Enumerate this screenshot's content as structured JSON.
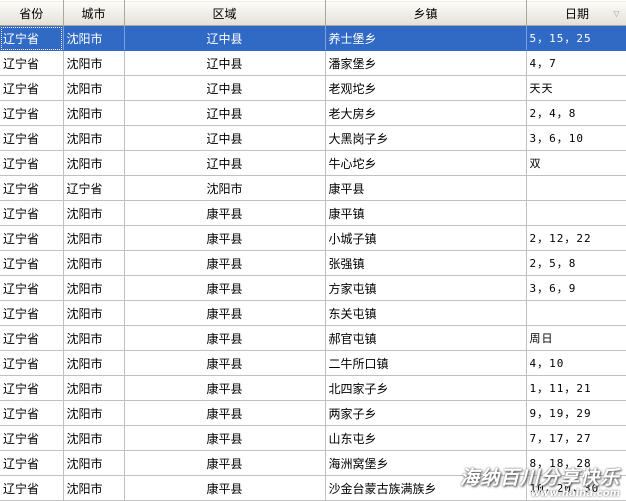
{
  "headers": {
    "province": "省份",
    "city": "城市",
    "area": "区域",
    "town": "乡镇",
    "date": "日期"
  },
  "sort_indicator": "▽",
  "rows": [
    {
      "province": "辽宁省",
      "city": "沈阳市",
      "area": "辽中县",
      "town": "养士堡乡",
      "date": "5，15，25",
      "selected": true
    },
    {
      "province": "辽宁省",
      "city": "沈阳市",
      "area": "辽中县",
      "town": "潘家堡乡",
      "date": "4，7"
    },
    {
      "province": "辽宁省",
      "city": "沈阳市",
      "area": "辽中县",
      "town": "老观坨乡",
      "date": "天天"
    },
    {
      "province": "辽宁省",
      "city": "沈阳市",
      "area": "辽中县",
      "town": "老大房乡",
      "date": "2，4，8"
    },
    {
      "province": "辽宁省",
      "city": "沈阳市",
      "area": "辽中县",
      "town": "大黑岗子乡",
      "date": "3，6，10"
    },
    {
      "province": "辽宁省",
      "city": "沈阳市",
      "area": "辽中县",
      "town": "牛心坨乡",
      "date": "双"
    },
    {
      "province": "辽宁省",
      "city": "辽宁省",
      "area": "沈阳市",
      "town": "康平县",
      "date": ""
    },
    {
      "province": "辽宁省",
      "city": "沈阳市",
      "area": "康平县",
      "town": "康平镇",
      "date": ""
    },
    {
      "province": "辽宁省",
      "city": "沈阳市",
      "area": "康平县",
      "town": "小城子镇",
      "date": "2，12，22"
    },
    {
      "province": "辽宁省",
      "city": "沈阳市",
      "area": "康平县",
      "town": "张强镇",
      "date": "2，5，8"
    },
    {
      "province": "辽宁省",
      "city": "沈阳市",
      "area": "康平县",
      "town": "方家屯镇",
      "date": "3，6，9"
    },
    {
      "province": "辽宁省",
      "city": "沈阳市",
      "area": "康平县",
      "town": "东关屯镇",
      "date": ""
    },
    {
      "province": "辽宁省",
      "city": "沈阳市",
      "area": "康平县",
      "town": "郝官屯镇",
      "date": "周日"
    },
    {
      "province": "辽宁省",
      "city": "沈阳市",
      "area": "康平县",
      "town": "二牛所口镇",
      "date": "4，10"
    },
    {
      "province": "辽宁省",
      "city": "沈阳市",
      "area": "康平县",
      "town": "北四家子乡",
      "date": "1，11，21"
    },
    {
      "province": "辽宁省",
      "city": "沈阳市",
      "area": "康平县",
      "town": "两家子乡",
      "date": "9，19，29"
    },
    {
      "province": "辽宁省",
      "city": "沈阳市",
      "area": "康平县",
      "town": "山东屯乡",
      "date": "7，17，27"
    },
    {
      "province": "辽宁省",
      "city": "沈阳市",
      "area": "康平县",
      "town": "海洲窝堡乡",
      "date": "8，18，28"
    },
    {
      "province": "辽宁省",
      "city": "沈阳市",
      "area": "康平县",
      "town": "沙金台蒙古族满族乡",
      "date": "10，20，30"
    }
  ],
  "watermark": {
    "title": "海纳百川分享快乐",
    "url": "www.haina.com"
  },
  "colors": {
    "selection": "#316ac5",
    "header_bg": "#ece9d8",
    "gridline": "#c0c0c0"
  }
}
